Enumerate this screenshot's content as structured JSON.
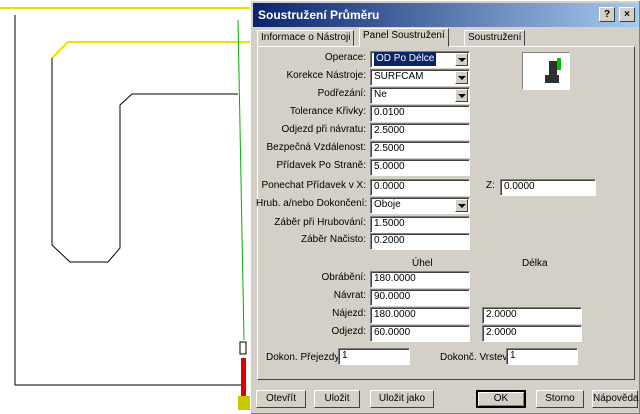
{
  "dialog": {
    "title": "Soustružení Průměru",
    "help_button": "?",
    "close_button": "×"
  },
  "tabs": [
    {
      "label": "Informace o Nástroji"
    },
    {
      "label": "Panel Soustružení"
    },
    {
      "label": "Soustružení"
    }
  ],
  "fields": {
    "operace": {
      "label": "Operace:",
      "value": "OD Po Délce"
    },
    "korekce": {
      "label": "Korekce Nástroje:",
      "value": "SURFCAM"
    },
    "podrezani": {
      "label": "Podřezání:",
      "value": "Ne"
    },
    "tolerance": {
      "label": "Tolerance Křivky:",
      "value": "0.0100"
    },
    "odjezd_navrat": {
      "label": "Odjezd při návratu:",
      "value": "2.5000"
    },
    "bezpecna": {
      "label": "Bezpečná Vzdálenost:",
      "value": "2.5000"
    },
    "pridavek_strane": {
      "label": "Přídavek Po Straně:",
      "value": "5.0000"
    },
    "pridavek_x": {
      "label": "Ponechat Přídavek v X:",
      "value": "0.0000"
    },
    "pridavek_z": {
      "label": "Z:",
      "value": "0.0000"
    },
    "hrub_dokonceni": {
      "label": "Hrub. a/nebo Dokončení:",
      "value": "Oboje"
    },
    "zaber_hrubovani": {
      "label": "Záběr při Hrubování:",
      "value": "1.5000"
    },
    "zaber_nacisto": {
      "label": "Záběr Načisto:",
      "value": "0.2000"
    }
  },
  "angles": {
    "col_uhel": "Úhel",
    "col_delka": "Délka",
    "rows": [
      {
        "label": "Obrábění:",
        "uhel": "180.0000",
        "delka": ""
      },
      {
        "label": "Návrat:",
        "uhel": "90.0000",
        "delka": ""
      },
      {
        "label": "Nájezd:",
        "uhel": "180.0000",
        "delka": "2.0000"
      },
      {
        "label": "Odjezd:",
        "uhel": "60.0000",
        "delka": "2.0000"
      }
    ]
  },
  "passes": {
    "dokon_prejezdy": {
      "label": "Dokon. Přejezdy:",
      "value": "1"
    },
    "dokonc_vrstev": {
      "label": "Dokonč. Vrstev:",
      "value": "1"
    }
  },
  "buttons": {
    "open": "Otevřít",
    "save": "Uložit",
    "save_as": "Uložit jako",
    "ok": "OK",
    "cancel": "Storno",
    "help": "Nápověda"
  }
}
